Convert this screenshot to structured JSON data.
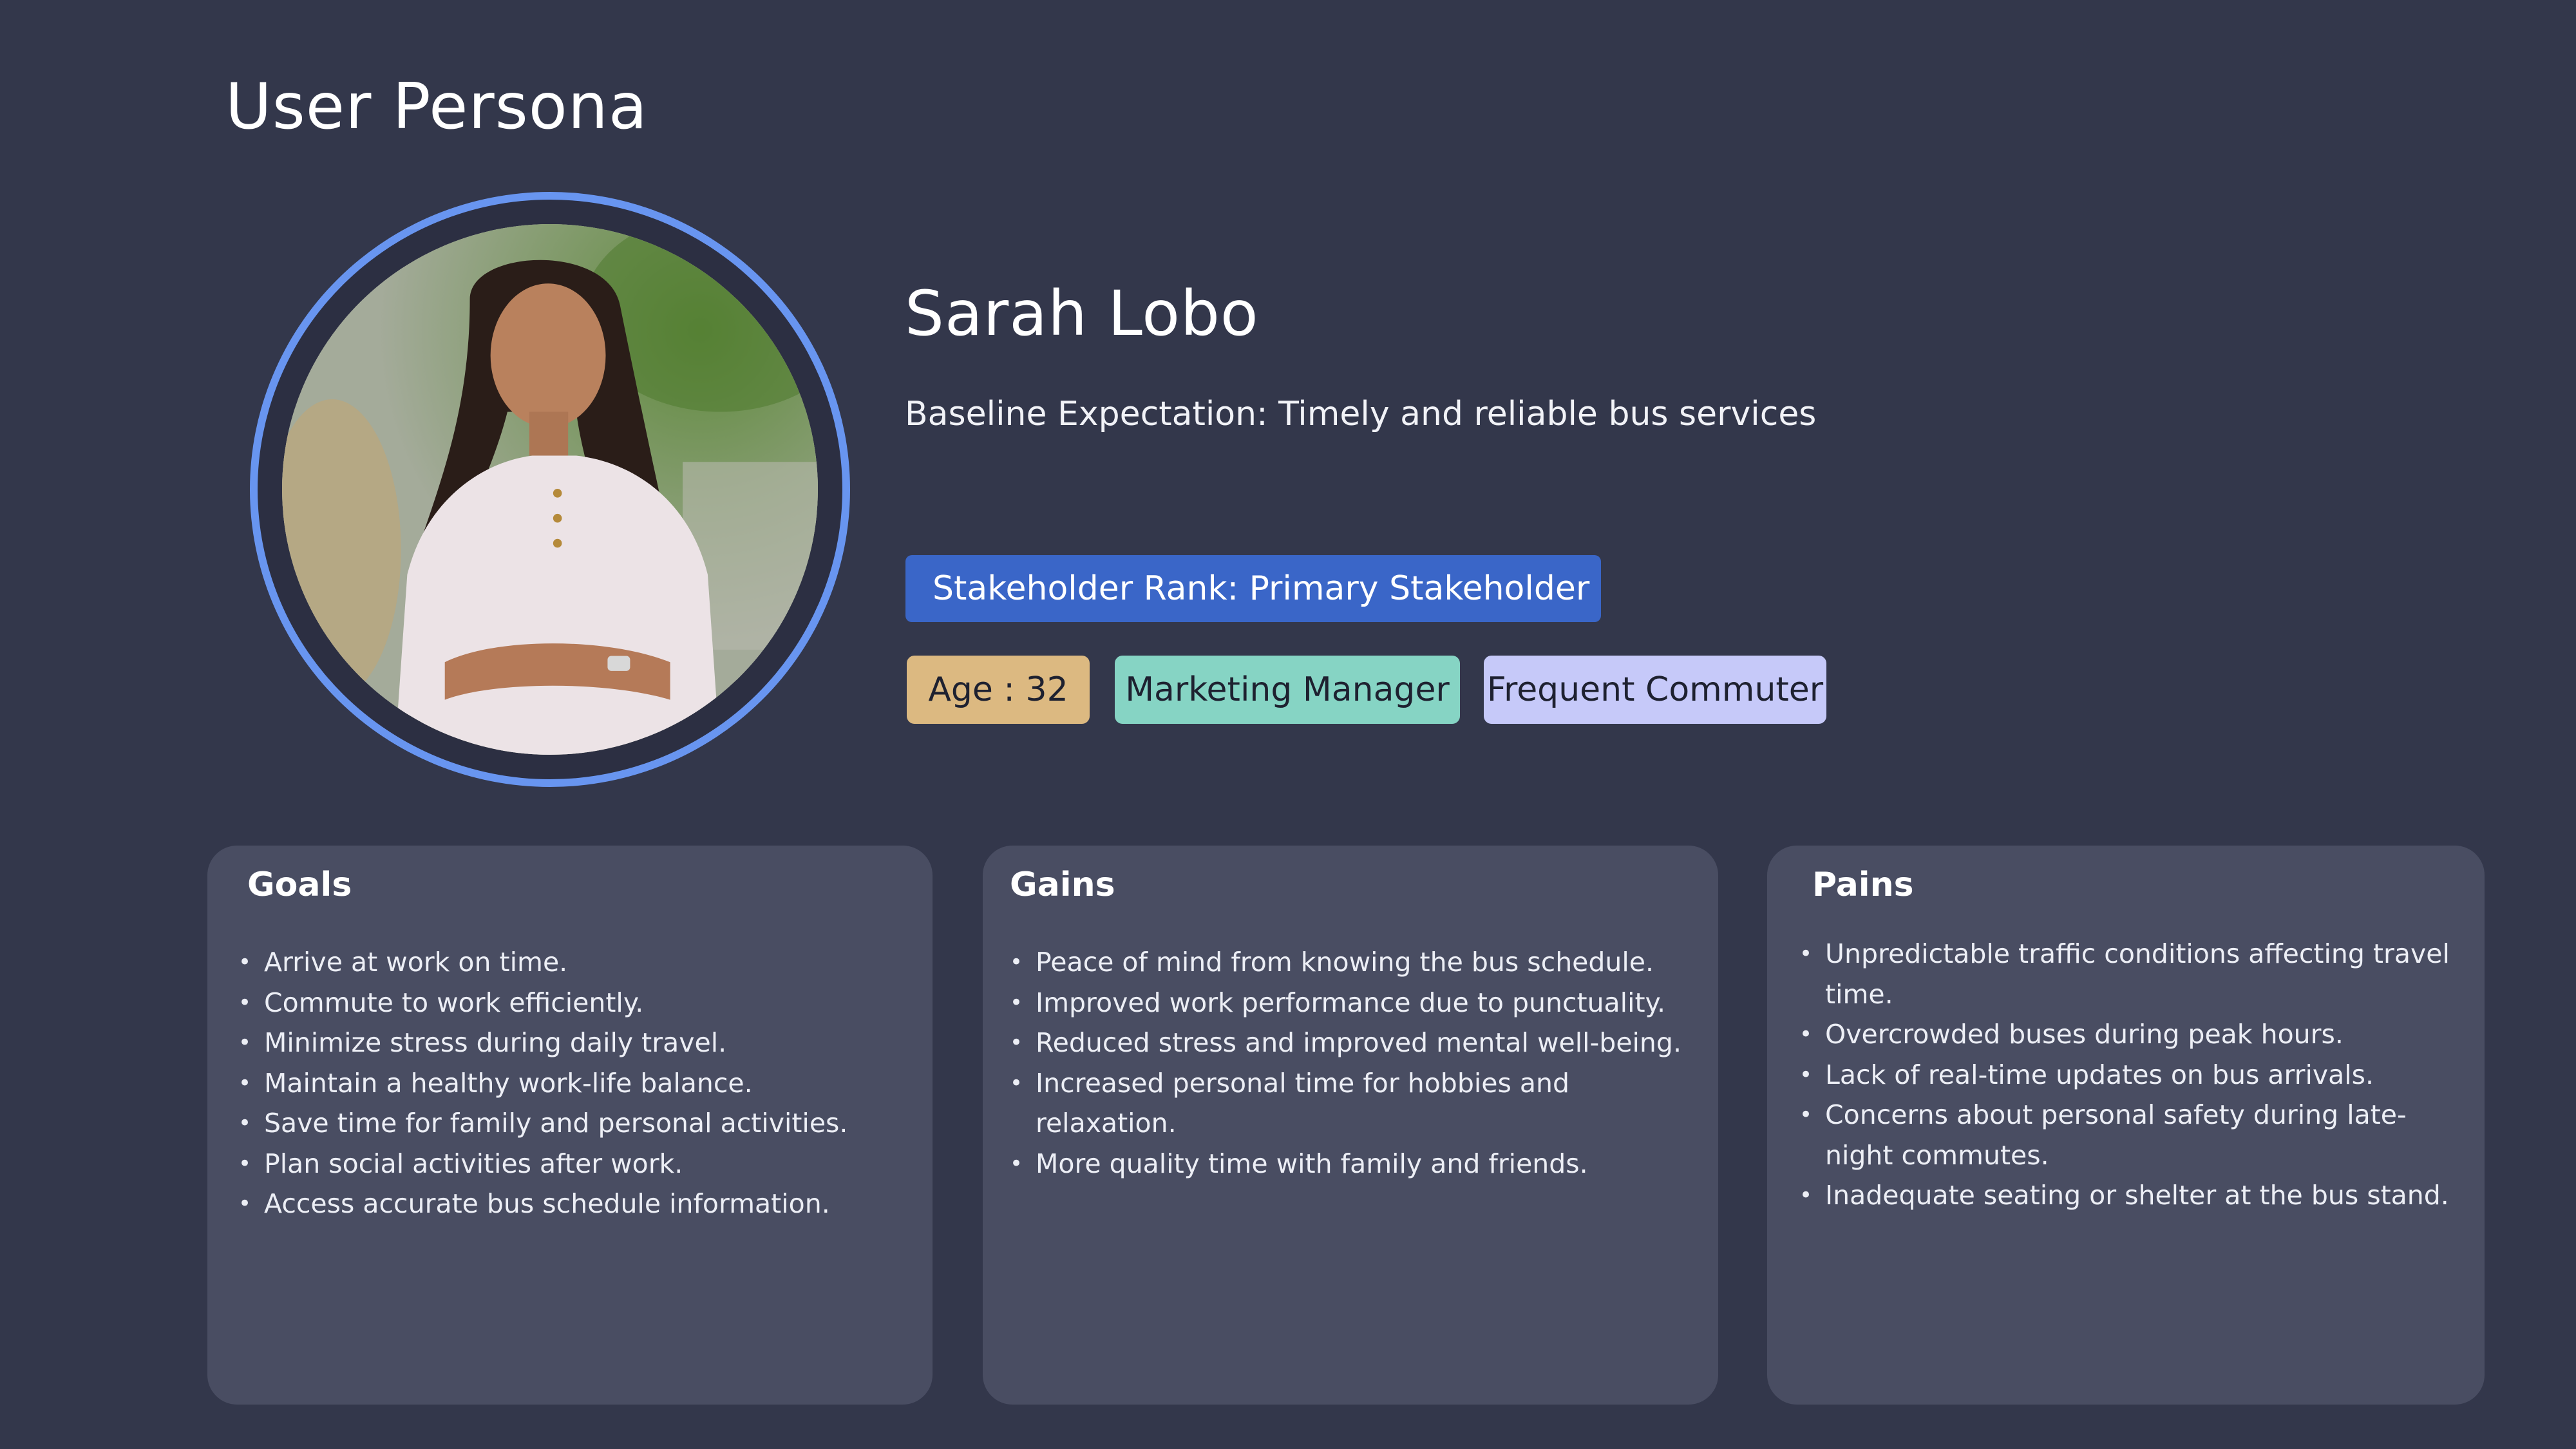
{
  "page": {
    "title": "User Persona"
  },
  "persona": {
    "name": "Sarah Lobo",
    "baseline": "Baseline Expectation: Timely and reliable bus services",
    "stakeholder_rank": "Stakeholder Rank: Primary Stakeholder",
    "tags": {
      "age": "Age : 32",
      "occupation": "Marketing Manager",
      "commuter_type": "Frequent Commuter"
    }
  },
  "cards": {
    "goals": {
      "title": "Goals",
      "items": [
        "Arrive at work on time.",
        "Commute to work efficiently.",
        "Minimize stress during daily travel.",
        "Maintain a healthy work-life balance.",
        "Save time for family and personal activities.",
        "Plan social activities after work.",
        "Access accurate bus schedule information."
      ]
    },
    "gains": {
      "title": "Gains",
      "items": [
        "Peace of mind from knowing the bus schedule.",
        "Improved work performance due to punctuality.",
        "Reduced stress and improved mental well-being.",
        "Increased personal time for hobbies and relaxation.",
        "More quality time with family and friends."
      ]
    },
    "pains": {
      "title": "Pains",
      "items": [
        "Unpredictable traffic conditions affecting travel time.",
        "Overcrowded buses during peak hours.",
        "Lack of real-time updates on bus arrivals.",
        "Concerns about personal safety during late-night commutes.",
        "Inadequate seating or shelter at the bus stand."
      ]
    }
  },
  "colors": {
    "background": "#33374b",
    "card": "#494d62",
    "ring": "#6895f0",
    "rank_badge": "#3a66c8",
    "tag_age": "#dcb981",
    "tag_occupation": "#86d4c4",
    "tag_commuter": "#c6c9f9"
  }
}
